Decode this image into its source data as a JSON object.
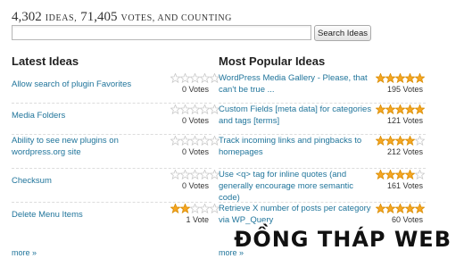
{
  "header": {
    "ideas_count": "4,302",
    "ideas_word": "ideas,",
    "votes_count": "71,405",
    "votes_word": "votes, and counting"
  },
  "search": {
    "value": "",
    "placeholder": "",
    "button_label": "Search Ideas"
  },
  "latest": {
    "title": "Latest Ideas",
    "items": [
      {
        "label": "Allow search of plugin Favorites",
        "rating": 0,
        "votes": "0 Votes"
      },
      {
        "label": "Media Folders",
        "rating": 0,
        "votes": "0 Votes"
      },
      {
        "label": "Ability to see new plugins on wordpress.org site",
        "rating": 0,
        "votes": "0 Votes"
      },
      {
        "label": "Checksum",
        "rating": 0,
        "votes": "0 Votes"
      },
      {
        "label": "Delete Menu Items",
        "rating": 2,
        "votes": "1 Vote"
      }
    ],
    "more_label": "more »"
  },
  "popular": {
    "title": "Most Popular Ideas",
    "items": [
      {
        "label": "WordPress Media Gallery - Please, that can't be true ...",
        "rating": 5,
        "votes": "195 Votes"
      },
      {
        "label": "Custom Fields [meta data] for categories and tags [terms]",
        "rating": 5,
        "votes": "121 Votes"
      },
      {
        "label": "Track incoming links and pingbacks to homepages",
        "rating": 4,
        "votes": "212 Votes"
      },
      {
        "label": "Use <q> tag for inline quotes (and generally encourage more semantic code)",
        "rating": 4,
        "votes": "161 Votes"
      },
      {
        "label": "Retrieve X number of posts per category via WP_Query",
        "rating": 5,
        "votes": "60 Votes"
      }
    ],
    "more_label": "more »"
  },
  "colors": {
    "link": "#21759b",
    "star_filled": "#f5a623",
    "star_empty": "#dddddd"
  },
  "watermark": "ĐỒNG THÁP WEB"
}
